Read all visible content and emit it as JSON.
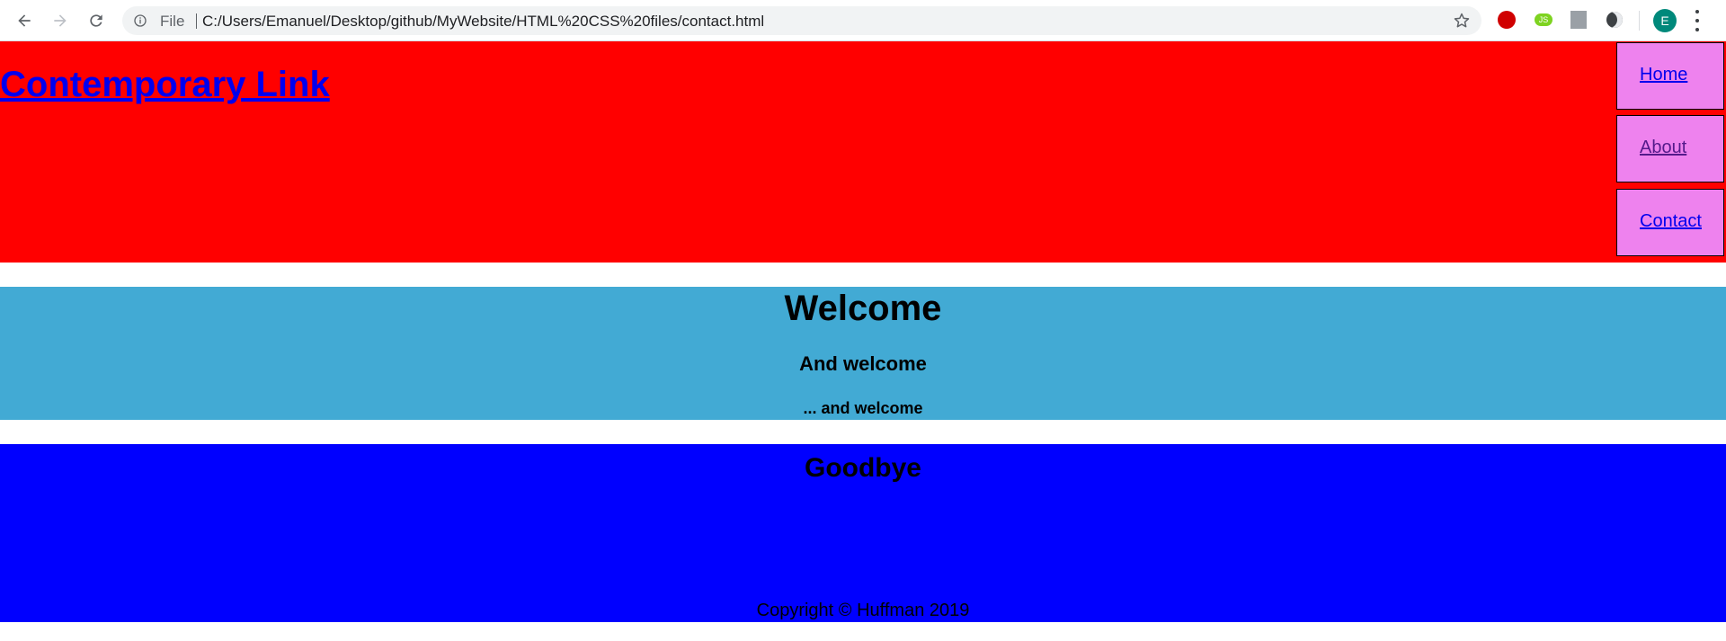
{
  "browser": {
    "scheme_label": "File",
    "url": "C:/Users/Emanuel/Desktop/github/MyWebsite/HTML%20CSS%20files/contact.html",
    "avatar_letter": "E",
    "icons": {
      "back": "arrow-left-icon",
      "forward": "arrow-right-icon",
      "reload": "reload-icon",
      "info": "info-icon",
      "bookmark": "star-icon",
      "menu": "more-vert-icon"
    },
    "extensions": [
      "stop-extension-icon",
      "js-extension-icon",
      "pdf-extension-icon",
      "dark-mode-extension-icon"
    ]
  },
  "site": {
    "title": "Contemporary Link",
    "nav": [
      {
        "label": "Home"
      },
      {
        "label": "About"
      },
      {
        "label": "Contact"
      }
    ]
  },
  "welcome": {
    "heading": "Welcome",
    "subheading": "And welcome",
    "subsubheading": "... and welcome"
  },
  "footer": {
    "heading": "Goodbye",
    "copyright": "Copyright © Huffman 2019"
  },
  "colors": {
    "header_bg": "#ff0000",
    "nav_box_bg": "#ee82ee",
    "welcome_bg": "#42aad4",
    "footer_bg": "#0000ff",
    "link": "#0000ee",
    "visited_link": "#551a8b"
  }
}
